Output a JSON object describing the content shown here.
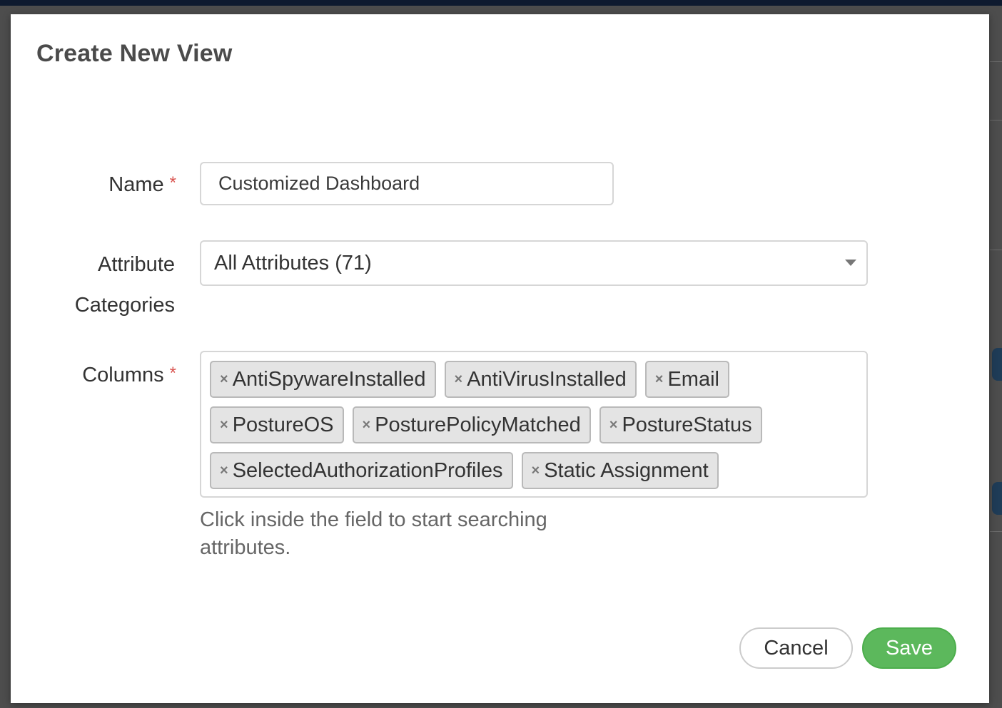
{
  "modal": {
    "title": "Create New View"
  },
  "form": {
    "name": {
      "label": "Name",
      "required_mark": "*",
      "value": "Customized Dashboard"
    },
    "attribute_categories": {
      "label_line1": "Attribute",
      "label_line2": "Categories",
      "selected": "All Attributes (71)"
    },
    "columns": {
      "label": "Columns",
      "required_mark": "*",
      "remove_symbol": "×",
      "tags": [
        "AntiSpywareInstalled",
        "AntiVirusInstalled",
        "Email",
        "PostureOS",
        "PosturePolicyMatched",
        "PostureStatus",
        "SelectedAuthorizationProfiles",
        "Static Assignment"
      ],
      "help_text": "Click inside the field to start searching attributes."
    }
  },
  "buttons": {
    "cancel": "Cancel",
    "save": "Save"
  },
  "colors": {
    "save_green": "#5cb85c",
    "required_red": "#d9534f",
    "tag_background": "#e4e4e4"
  }
}
